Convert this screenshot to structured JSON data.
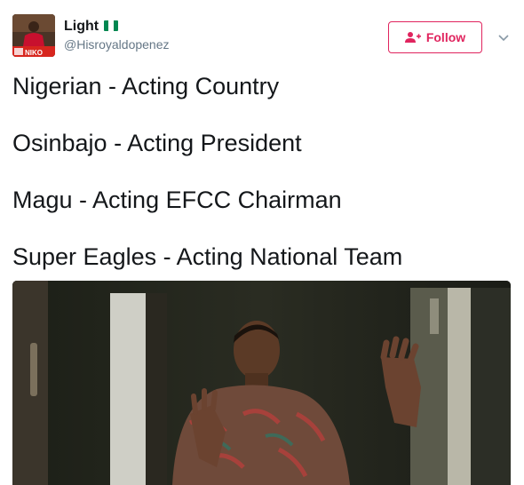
{
  "user": {
    "display_name": "Light",
    "username": "@Hisroyaldopenez",
    "avatar_icon": "profile-photo",
    "flag_icon": "nigeria-flag-icon",
    "flag_colors": [
      "#008751",
      "#ffffff",
      "#008751"
    ]
  },
  "actions": {
    "follow_label": "Follow",
    "follow_icon": "add-person-icon",
    "more_icon": "chevron-down-icon",
    "accent_color": "#e0245e"
  },
  "tweet": {
    "lines": [
      "Nigerian - Acting Country",
      "Osinbajo - Acting President",
      "Magu - Acting EFCC Chairman",
      "Super Eagles - Acting National Team"
    ]
  },
  "media": {
    "type": "photo",
    "content": "man in patterned shirt holding hands up against glass door"
  }
}
